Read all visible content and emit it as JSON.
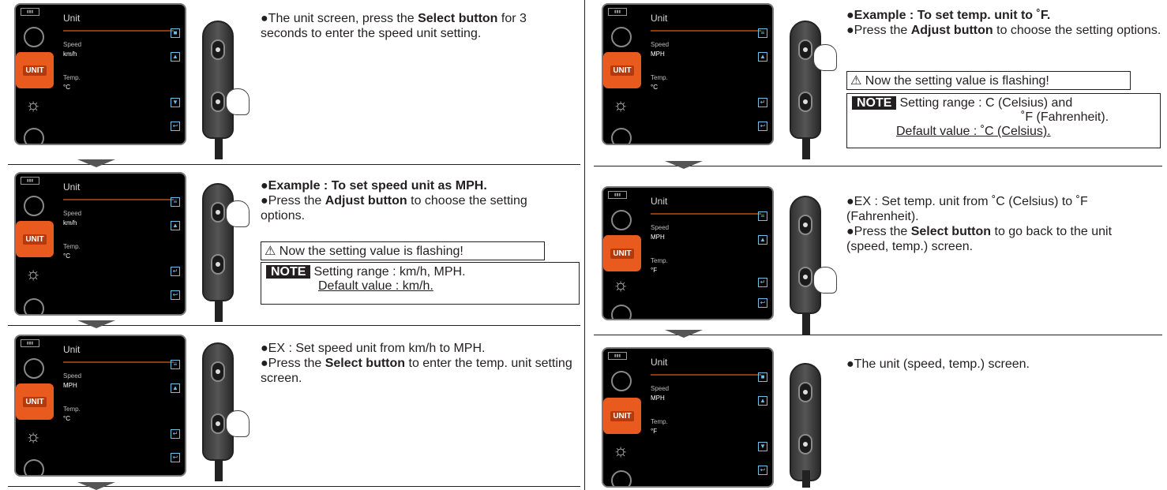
{
  "screen_labels": {
    "title": "Unit",
    "speed_label": "Speed",
    "temp_label": "Temp.",
    "unit_button": "UNIT"
  },
  "left": {
    "step1": {
      "speed": "km/h",
      "temp": "°C",
      "text_pre": "The unit screen, press the ",
      "text_bold": "Select button",
      "text_post": " for 3 seconds to enter the speed unit setting."
    },
    "step2": {
      "speed": "km/h",
      "temp": "°C",
      "example": "Example : To set speed unit as MPH.",
      "line_pre": "Press the ",
      "line_bold": "Adjust button",
      "line_post": " to choose the setting options.",
      "warning": "Now the setting value is flashing!",
      "note_tag": "NOTE",
      "note_range": "Setting range : km/h, MPH.",
      "note_default": "Default value : km/h."
    },
    "step3": {
      "speed": "MPH",
      "temp": "°C",
      "ex": "EX : Set speed unit from km/h to MPH.",
      "line_pre": "Press the ",
      "line_bold": "Select button",
      "line_post": " to enter the temp. unit setting screen."
    }
  },
  "right": {
    "step4": {
      "speed": "MPH",
      "temp": "°C",
      "example": "Example : To set temp. unit to ˚F.",
      "line_pre": "Press the ",
      "line_bold": "Adjust button",
      "line_post": " to choose the setting options.",
      "warning": "Now the setting value is flashing!",
      "note_tag": "NOTE",
      "note_range": "Setting range : C (Celsius) and",
      "note_range2": "˚F (Fahrenheit).",
      "note_default": "Default value : ˚C (Celsius)."
    },
    "step5": {
      "speed": "MPH",
      "temp": "°F",
      "ex": "EX : Set temp. unit from ˚C (Celsius) to ˚F (Fahrenheit).",
      "line_pre": "Press the ",
      "line_bold": "Select button",
      "line_post": " to go back to the unit (speed, temp.) screen."
    },
    "step6": {
      "speed": "MPH",
      "temp": "°F",
      "text": "The unit (speed, temp.) screen."
    }
  },
  "bullet": "●",
  "warning_icon": "warning-triangle-icon",
  "colors": {
    "unit_orange": "#e85a1e",
    "icon_blue": "#6ec0e8",
    "divider_red": "#8a3a10"
  }
}
